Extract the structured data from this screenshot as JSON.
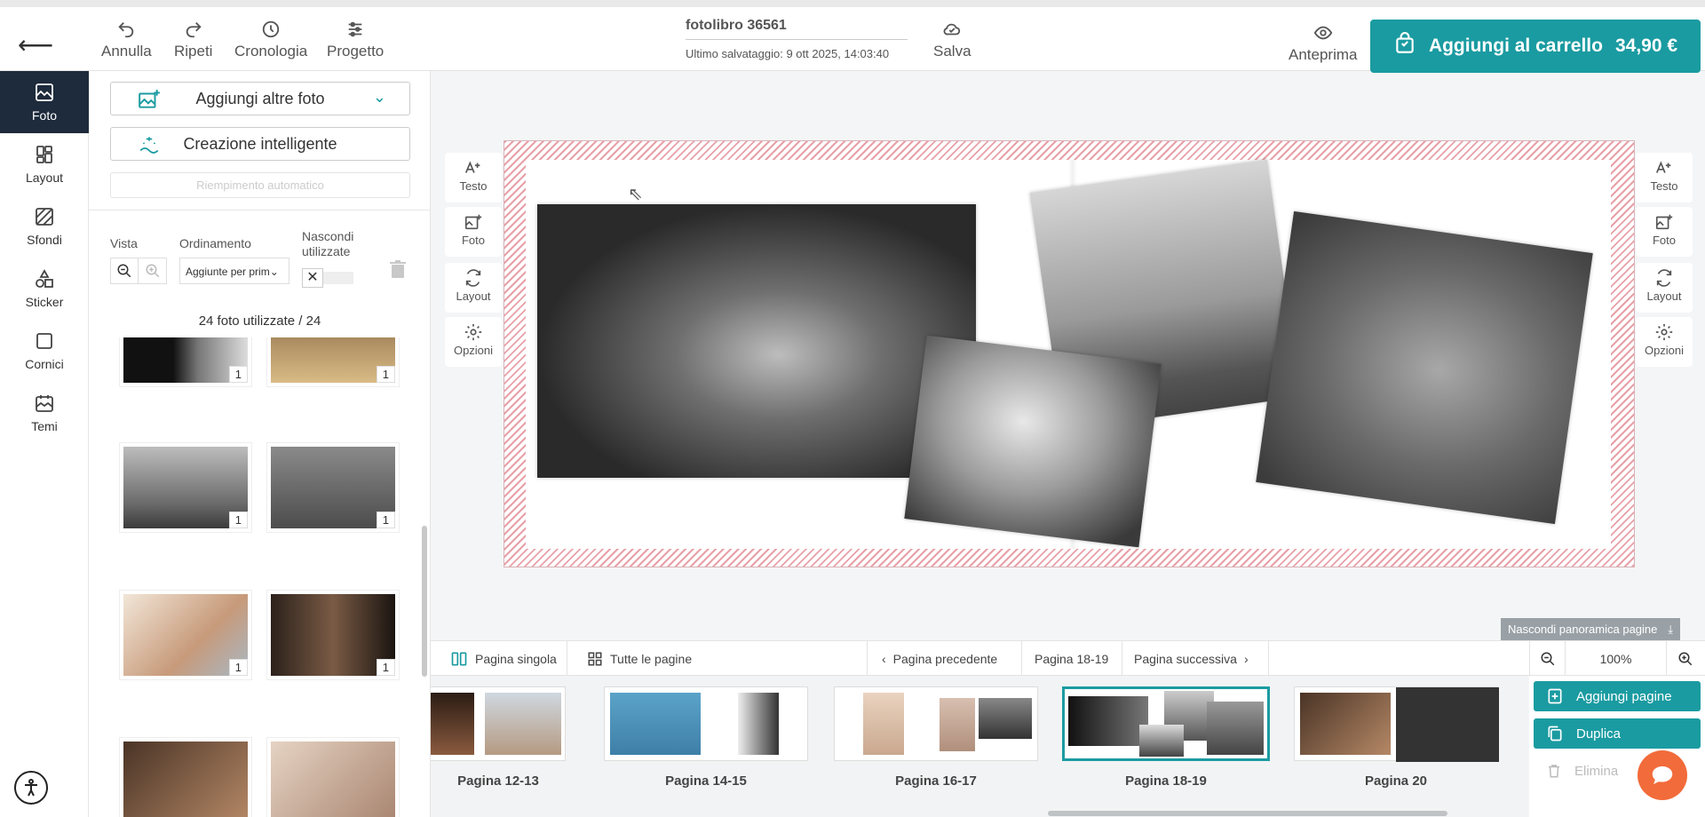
{
  "topbar": {
    "undo": "Annulla",
    "redo": "Ripeti",
    "history": "Cronologia",
    "project": "Progetto",
    "project_name": "fotolibro 36561",
    "last_saved": "Ultimo salvataggio:  9 ott 2025, 14:03:40",
    "save": "Salva",
    "preview": "Anteprima",
    "add_to_cart": "Aggiungi al carrello",
    "price": "34,90 €"
  },
  "leftnav": [
    {
      "label": "Foto",
      "icon": "photos-icon"
    },
    {
      "label": "Layout",
      "icon": "layout-icon"
    },
    {
      "label": "Sfondi",
      "icon": "backgrounds-icon"
    },
    {
      "label": "Sticker",
      "icon": "sticker-icon"
    },
    {
      "label": "Cornici",
      "icon": "frames-icon"
    },
    {
      "label": "Temi",
      "icon": "themes-icon"
    }
  ],
  "panel": {
    "add_photos": "Aggiungi altre foto",
    "smart_creation": "Creazione intelligente",
    "auto_fill": "Riempimento automatico",
    "view_label": "Vista",
    "sort_label": "Ordinamento",
    "sort_value": "Aggiunte per prim",
    "hide_used_label_1": "Nascondi",
    "hide_used_label_2": "utilizzate",
    "photos_used": "24 foto utilizzate / 24",
    "thumbs": [
      {
        "count": "1",
        "color": "#2e2e2e"
      },
      {
        "count": "1",
        "color": "#c9a572"
      },
      {
        "count": "1",
        "color": "#8d8d8d"
      },
      {
        "count": "1",
        "color": "#6e6e6e"
      },
      {
        "count": "1",
        "color": "#d9c2a8"
      },
      {
        "count": "1",
        "color": "#3a2c24"
      },
      {
        "count": "",
        "color": "#7a5a45"
      },
      {
        "count": "",
        "color": "#c8b1a0"
      }
    ]
  },
  "tools": {
    "text": "Testo",
    "photo": "Foto",
    "layout": "Layout",
    "options": "Opzioni"
  },
  "bottombar": {
    "single_page": "Pagina singola",
    "all_pages": "Tutte le pagine",
    "prev_page": "Pagina precedente",
    "current_page": "Pagina 18-19",
    "next_page": "Pagina successiva",
    "zoom": "100%",
    "hide_overview": "Nascondi panoramica pagine"
  },
  "strip": [
    {
      "label": "Pagina 12-13"
    },
    {
      "label": "Pagina 14-15"
    },
    {
      "label": "Pagina 16-17"
    },
    {
      "label": "Pagina 18-19"
    },
    {
      "label": "Pagina 20"
    }
  ],
  "actions": {
    "add_pages": "Aggiungi pagine",
    "duplicate": "Duplica",
    "delete": "Elimina"
  },
  "colors": {
    "accent": "#1a9ba1",
    "nav_active": "#1e2b3c",
    "chat": "#f26b3a"
  }
}
